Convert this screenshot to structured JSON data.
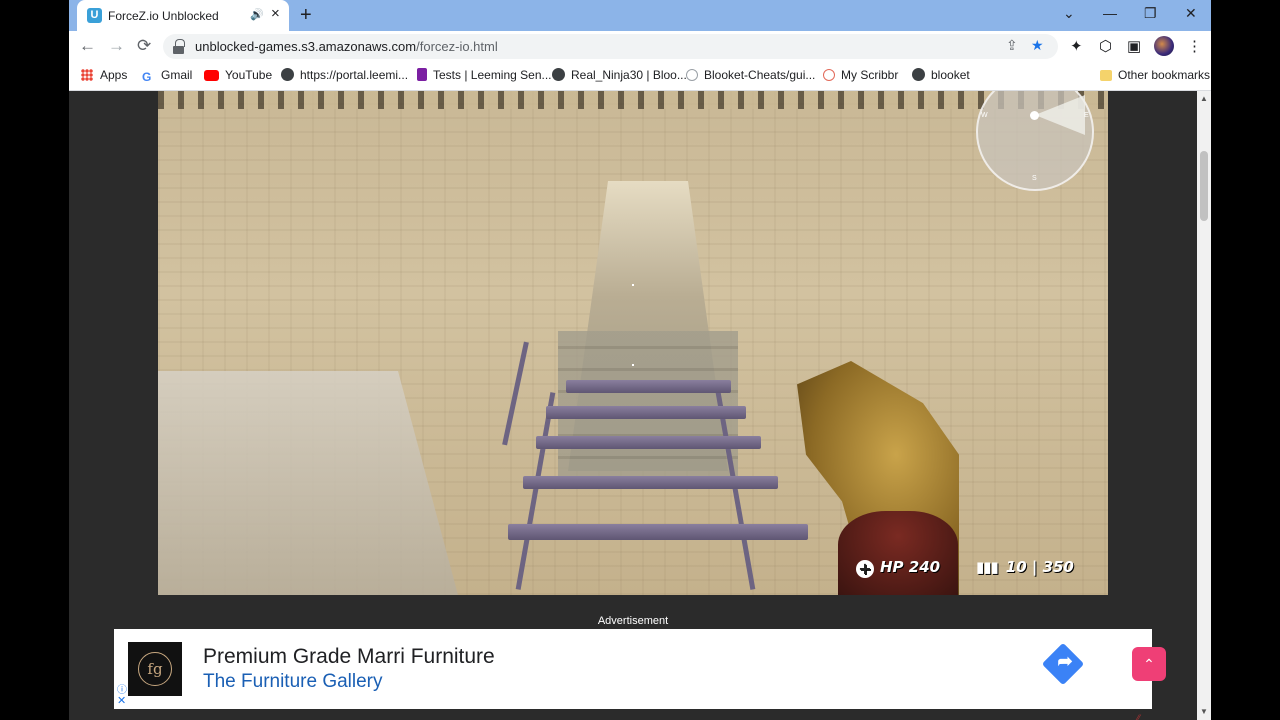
{
  "browser": {
    "tab": {
      "title": "ForceZ.io Unblocked",
      "favicon_letter": "U"
    },
    "new_tab_icon": "+",
    "window_controls": {
      "tab_search": "⌄",
      "minimize": "—",
      "restore": "❐",
      "close": "✕"
    },
    "toolbar": {
      "back": "←",
      "forward": "→",
      "reload": "⟳",
      "url_host": "unblocked-games.s3.amazonaws.com",
      "url_path": "/forcez-io.html",
      "share": "⇪",
      "bookmark_star": "★",
      "extensions": "✦",
      "sidebar": "▣",
      "menu": "⋮"
    },
    "bookmarks": [
      {
        "label": "Apps",
        "icon": "apps-grid-icon",
        "color": "#ea4335"
      },
      {
        "label": "Gmail",
        "icon": "google-icon",
        "color": "#4285f4"
      },
      {
        "label": "YouTube",
        "icon": "youtube-icon",
        "color": "#ff0000"
      },
      {
        "label": "https://portal.leemi...",
        "icon": "globe-icon",
        "color": "#3c4043"
      },
      {
        "label": "Tests | Leeming Sen...",
        "icon": "doc-icon",
        "color": "#7b1fa2"
      },
      {
        "label": "Real_Ninja30 | Bloo...",
        "icon": "globe-icon",
        "color": "#3c4043"
      },
      {
        "label": "Blooket-Cheats/gui...",
        "icon": "github-icon",
        "color": "#9aa0a6"
      },
      {
        "label": "My Scribbr",
        "icon": "scribbr-icon",
        "color": "#e26a5a"
      },
      {
        "label": "blooket",
        "icon": "globe-icon",
        "color": "#3c4043"
      }
    ],
    "other_bookmarks": "Other bookmarks"
  },
  "game": {
    "hud": {
      "hp": "HP 240",
      "ammo": "10 | 350"
    },
    "minimap": {
      "w": "W",
      "e": "E",
      "s": "S"
    }
  },
  "ad": {
    "label": "Advertisement",
    "title": "Premium Grade Marri Furniture",
    "subtitle": "The Furniture Gallery",
    "logo_text": "fg",
    "info_icon": "ⓘ",
    "close_icon": "✕",
    "arrow_icon": "➦"
  },
  "scroll_to_top": "⌃"
}
